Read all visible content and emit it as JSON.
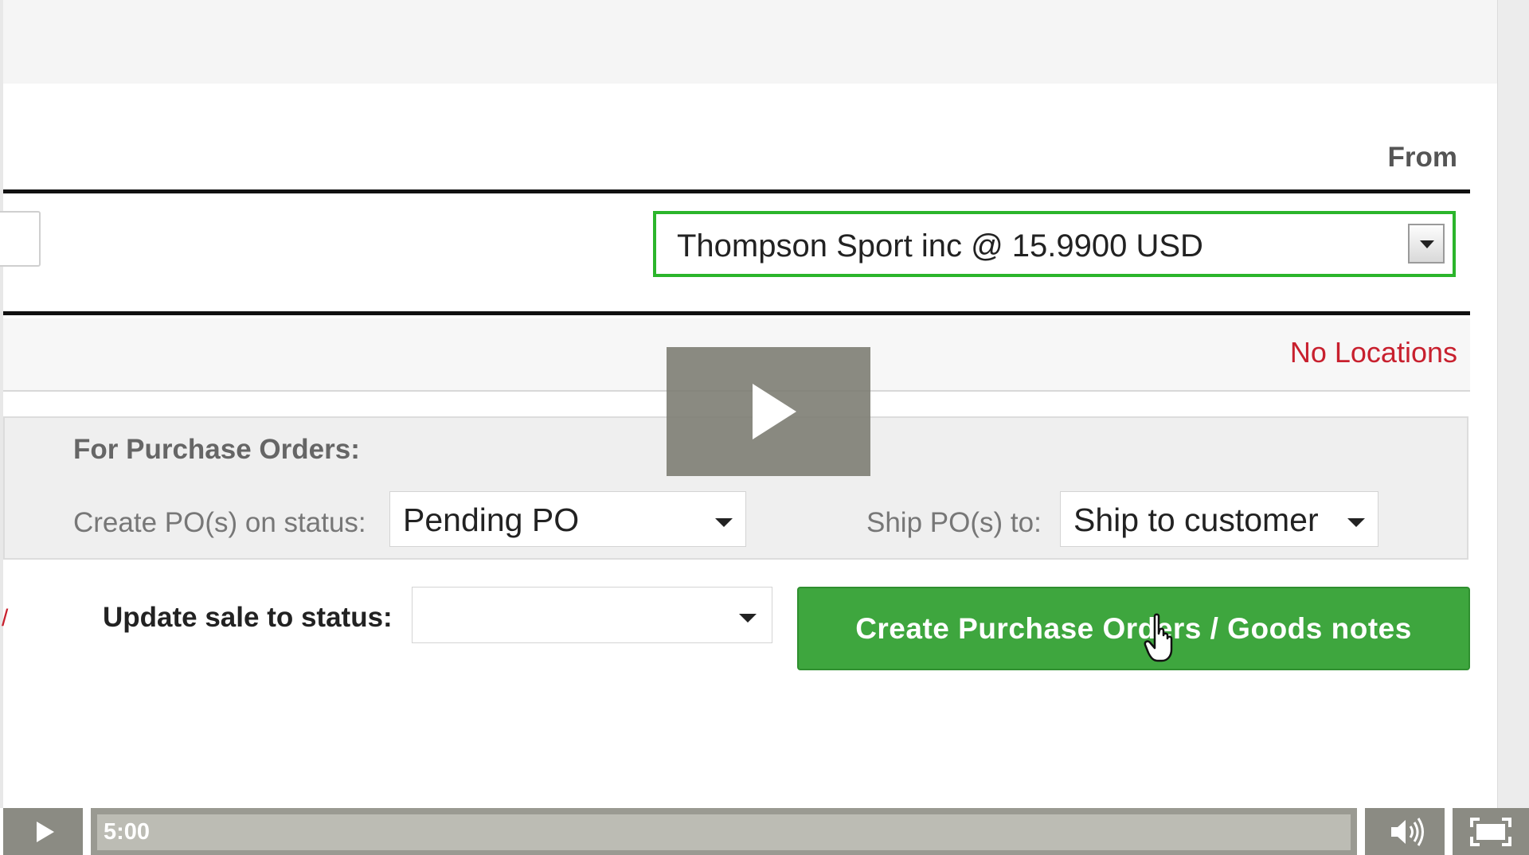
{
  "header": {
    "from_label": "From"
  },
  "supplier": {
    "selected_value": "Thompson Sport inc @ 15.9900 USD"
  },
  "locations": {
    "status_text": "No Locations"
  },
  "purchase_orders": {
    "heading": "For Purchase Orders:",
    "create_status_label": "Create PO(s) on status:",
    "create_status_value": "Pending PO",
    "ship_to_label": "Ship PO(s) to:",
    "ship_to_value": "Ship to customer"
  },
  "update_sale": {
    "label": "Update sale to status:",
    "value": ""
  },
  "actions": {
    "create_button_label": "Create Purchase Orders / Goods notes"
  },
  "video_player": {
    "current_time": "5:00",
    "icons": {
      "overlay": "play-icon",
      "play": "play-icon",
      "volume": "volume-icon",
      "fullscreen": "fullscreen-icon"
    },
    "colors": {
      "overlay_bg": "#7d7d73",
      "control_bg": "#8b8b83",
      "progress_track": "#bcbcb4"
    }
  },
  "colors": {
    "accent_green": "#3ea63e",
    "focus_border_green": "#2bb52b",
    "warning_red": "#c8202e"
  }
}
